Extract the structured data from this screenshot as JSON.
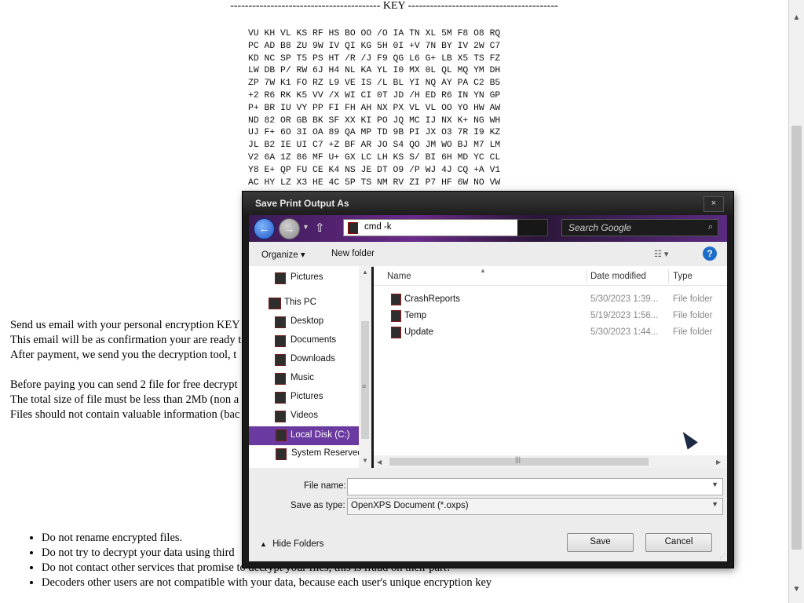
{
  "document": {
    "key_heading": "----------------------------------------- KEY -----------------------------------------",
    "key_lines": [
      "VU KH VL KS RF HS BO OO /O IA TN XL 5M F8 O8 RQ",
      "PC AD B8 ZU 9W IV QI KG 5H 0I +V 7N BY IV 2W C7",
      "KD NC SP T5 PS HT /R /J F9 QG L6 G+ LB X5 TS FZ",
      "LW DB P/ RW 6J H4 NL KA YL I0 MX 0L QL MQ YM DH",
      "ZP 7W K1 FO RZ L9 VE IS /L BL YI NQ AY PA C2 B5",
      "+2 R6 RK K5 VV /X WI CI 0T JD /H ED R6 IN YN GP",
      "P+ BR IU VY PP FI FH AH NX PX VL VL OO YO HW AW",
      "ND 82 OR GB BK SF XX KI PO JQ MC IJ NX K+ NG WH",
      "UJ F+ 6O 3I OA 89 QA MP TD 9B PI JX O3 7R I9 KZ",
      "JL B2 IE UI C7 +Z BF AR JO S4 QO JM WO BJ M7 LM",
      "V2 6A 1Z 86 MF U+ GX LC LH KS S/ BI 6H MD YC CL",
      "Y8 E+ QP FU CE K4 NS JE DT O9 /P WJ 4J CQ +A V1",
      "AC HY LZ X3 HE 4C 5P TS NM RV ZI P7 HF 6W NO VW"
    ],
    "paragraph1": [
      "Send us email with your personal encryption KEY",
      "This email will be as confirmation your are ready t",
      "After payment, we send you the decryption tool, t"
    ],
    "paragraph2": [
      "Before paying you can send 2 file for free decrypt",
      "The total size of file must be less than 2Mb (non a",
      "Files should not contain valuable information (bac"
    ],
    "notes": [
      "Do not rename encrypted files.",
      "Do not try to decrypt your data using third",
      "Do not contact other services that promise to decrypt your files, this is fraud on their part!",
      "Decoders other users are not compatible with your data, because each user's unique encryption key"
    ]
  },
  "dialog": {
    "title": "Save Print Output As",
    "close_label": "×",
    "address": "cmd -k",
    "search_placeholder": "Search Google",
    "toolbar": {
      "organize": "Organize ▾",
      "new_folder": "New folder",
      "view": "☷ ▾",
      "help": "?"
    },
    "nav": {
      "pinned": {
        "label": "Pictures"
      },
      "this_pc": "This PC",
      "items": [
        "Desktop",
        "Documents",
        "Downloads",
        "Music",
        "Pictures",
        "Videos",
        "Local Disk (C:)",
        "System Reserved"
      ]
    },
    "columns": {
      "name": "Name",
      "date_modified": "Date modified",
      "type": "Type"
    },
    "files": [
      {
        "name": "CrashReports",
        "date": "5/30/2023 1:39...",
        "type": "File folder"
      },
      {
        "name": "Temp",
        "date": "5/19/2023 1:56...",
        "type": "File folder"
      },
      {
        "name": "Update",
        "date": "5/30/2023 1:44...",
        "type": "File folder"
      }
    ],
    "file_name_label": "File name:",
    "file_name_value": "",
    "save_type_label": "Save as type:",
    "save_type_value": "OpenXPS Document (*.oxps)",
    "hide_folders": "Hide Folders",
    "save_label": "Save",
    "cancel_label": "Cancel"
  },
  "colors": {
    "nav_selected": "#6a3aa0",
    "dialog_frame": "#1a1a1a",
    "accent_purple": "#6a2a8a"
  }
}
